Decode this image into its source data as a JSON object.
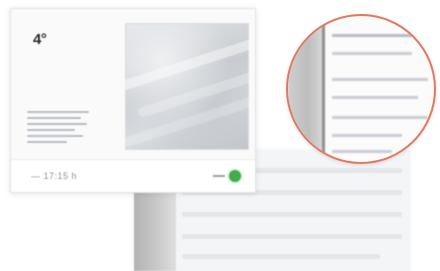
{
  "card": {
    "temperature": "4°",
    "footer_text": "— 17:15 h",
    "status_color": "#3fae49"
  },
  "magnifier": {
    "border_color": "#e07a5f"
  }
}
